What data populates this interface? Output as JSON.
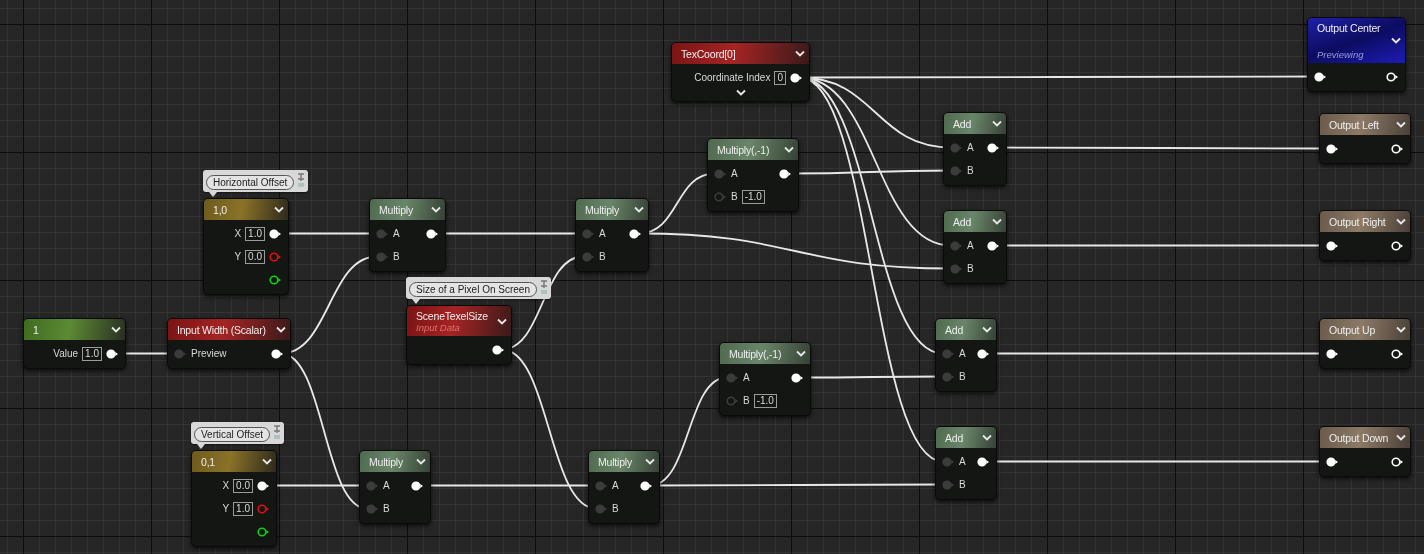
{
  "nodes": [
    {
      "title": "1",
      "kind": "constant",
      "rows": [
        {
          "label": "Value",
          "value": "1.0",
          "out_pin": {
            "linked": true
          }
        }
      ]
    },
    {
      "title": "1,0",
      "kind": "vector",
      "comment": "Horizontal Offset",
      "rows": [
        {
          "label": "X",
          "value": "1.0",
          "out_pin": {
            "linked": true
          }
        },
        {
          "label": "Y",
          "value": "0.0",
          "out_pin": {
            "linked": false,
            "color": "#e01010"
          }
        },
        {
          "out_pin": {
            "linked": false,
            "color": "#10d010"
          }
        }
      ]
    },
    {
      "title": "Input Width (Scalar)",
      "kind": "input",
      "rows": [
        {
          "label": "Preview",
          "in_pin": {
            "linked": true
          },
          "out_pin": {
            "linked": true
          }
        }
      ]
    },
    {
      "title": "0,1",
      "kind": "vector",
      "comment": "Vertical Offset",
      "rows": [
        {
          "label": "X",
          "value": "0.0",
          "out_pin": {
            "linked": true
          }
        },
        {
          "label": "Y",
          "value": "1.0",
          "out_pin": {
            "linked": false,
            "color": "#e01010"
          }
        },
        {
          "out_pin": {
            "linked": false,
            "color": "#10d010"
          }
        }
      ]
    },
    {
      "title": "Multiply",
      "kind": "math",
      "rows": [
        {
          "label": "A",
          "in_pin": {
            "linked": true
          },
          "out_pin": {
            "linked": true
          }
        },
        {
          "label": "B",
          "in_pin": {
            "linked": true
          }
        }
      ]
    },
    {
      "title": "Multiply",
      "kind": "math",
      "rows": [
        {
          "label": "A",
          "in_pin": {
            "linked": true
          },
          "out_pin": {
            "linked": true
          }
        },
        {
          "label": "B",
          "in_pin": {
            "linked": true
          }
        }
      ]
    },
    {
      "title": "SceneTexelSize",
      "subtitle": "Input Data",
      "kind": "input",
      "comment": "Size of a Pixel On Screen",
      "rows": [
        {
          "out_pin": {
            "linked": true
          }
        }
      ]
    },
    {
      "title": "Multiply",
      "kind": "math",
      "rows": [
        {
          "label": "A",
          "in_pin": {
            "linked": true
          },
          "out_pin": {
            "linked": true
          }
        },
        {
          "label": "B",
          "in_pin": {
            "linked": true
          }
        }
      ]
    },
    {
      "title": "Multiply",
      "kind": "math",
      "rows": [
        {
          "label": "A",
          "in_pin": {
            "linked": true
          },
          "out_pin": {
            "linked": true
          }
        },
        {
          "label": "B",
          "in_pin": {
            "linked": true
          }
        }
      ]
    },
    {
      "title": "TexCoord[0]",
      "kind": "input",
      "show_more": true,
      "rows": [
        {
          "label": "Coordinate Index",
          "value": "0",
          "out_pin": {
            "linked": true
          }
        }
      ]
    },
    {
      "title": "Multiply(,-1)",
      "kind": "math",
      "rows": [
        {
          "label": "A",
          "in_pin": {
            "linked": true
          },
          "out_pin": {
            "linked": true
          }
        },
        {
          "label": "B",
          "value": "-1.0",
          "in_pin": {
            "linked": false
          }
        }
      ]
    },
    {
      "title": "Multiply(,-1)",
      "kind": "math",
      "rows": [
        {
          "label": "A",
          "in_pin": {
            "linked": true
          },
          "out_pin": {
            "linked": true
          }
        },
        {
          "label": "B",
          "value": "-1.0",
          "in_pin": {
            "linked": false
          }
        }
      ]
    },
    {
      "title": "Add",
      "kind": "math",
      "rows": [
        {
          "label": "A",
          "in_pin": {
            "linked": true
          },
          "out_pin": {
            "linked": true
          }
        },
        {
          "label": "B",
          "in_pin": {
            "linked": true
          }
        }
      ]
    },
    {
      "title": "Add",
      "kind": "math",
      "rows": [
        {
          "label": "A",
          "in_pin": {
            "linked": true
          },
          "out_pin": {
            "linked": true
          }
        },
        {
          "label": "B",
          "in_pin": {
            "linked": true
          }
        }
      ]
    },
    {
      "title": "Add",
      "kind": "math",
      "rows": [
        {
          "label": "A",
          "in_pin": {
            "linked": true
          },
          "out_pin": {
            "linked": true
          }
        },
        {
          "label": "B",
          "in_pin": {
            "linked": true
          }
        }
      ]
    },
    {
      "title": "Add",
      "kind": "math",
      "rows": [
        {
          "label": "A",
          "in_pin": {
            "linked": true
          },
          "out_pin": {
            "linked": true
          }
        },
        {
          "label": "B",
          "in_pin": {
            "linked": true
          }
        }
      ]
    },
    {
      "title": "Output Center",
      "subtitle": "Previewing",
      "kind": "preview",
      "rows": [
        {
          "in_pin": {
            "linked": true
          },
          "out_pin": {
            "linked": false
          }
        }
      ]
    },
    {
      "title": "Output Left",
      "kind": "output",
      "rows": [
        {
          "in_pin": {
            "linked": true
          },
          "out_pin": {
            "linked": false
          }
        }
      ]
    },
    {
      "title": "Output Right",
      "kind": "output",
      "rows": [
        {
          "in_pin": {
            "linked": true
          },
          "out_pin": {
            "linked": false
          }
        }
      ]
    },
    {
      "title": "Output Up",
      "kind": "output",
      "rows": [
        {
          "in_pin": {
            "linked": true
          },
          "out_pin": {
            "linked": false
          }
        }
      ]
    },
    {
      "title": "Output Down",
      "kind": "output",
      "rows": [
        {
          "in_pin": {
            "linked": true
          },
          "out_pin": {
            "linked": false
          }
        }
      ]
    }
  ]
}
